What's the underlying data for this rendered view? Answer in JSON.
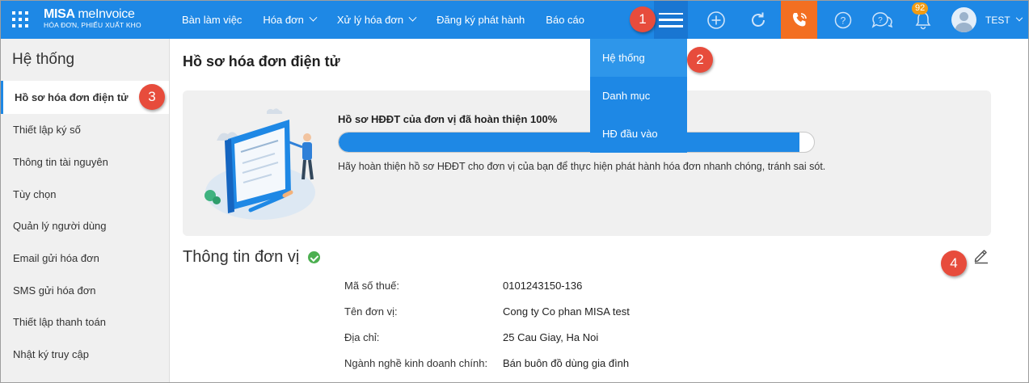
{
  "header": {
    "logo_main_bold": "MISA",
    "logo_main_light": "meInvoice",
    "logo_sub": "HÓA ĐƠN, PHIẾU XUẤT KHO",
    "nav": [
      {
        "label": "Bàn làm việc",
        "has_dropdown": false
      },
      {
        "label": "Hóa đơn",
        "has_dropdown": true
      },
      {
        "label": "Xử lý hóa đơn",
        "has_dropdown": true
      },
      {
        "label": "Đăng ký phát hành",
        "has_dropdown": false
      },
      {
        "label": "Báo cáo",
        "has_dropdown": false
      }
    ],
    "notification_count": "92",
    "user_name": "TEST",
    "icons": [
      "apps-grid-icon",
      "hamburger-icon",
      "plus-circle-icon",
      "refresh-icon",
      "phone-icon",
      "help-icon",
      "chat-icon",
      "bell-icon"
    ],
    "accent_color": "#1e88e5",
    "phone_color": "#f36f21"
  },
  "dropdown": {
    "items": [
      "Hệ thống",
      "Danh mục",
      "HĐ đầu vào"
    ]
  },
  "sidebar": {
    "title": "Hệ thống",
    "items": [
      "Hồ sơ hóa đơn điện tử",
      "Thiết lập ký số",
      "Thông tin tài nguyên",
      "Tùy chọn",
      "Quản lý người dùng",
      "Email gửi hóa đơn",
      "SMS gửi hóa đơn",
      "Thiết lập thanh toán",
      "Nhật ký truy cập"
    ]
  },
  "main": {
    "page_title": "Hồ sơ hóa đơn điện tử",
    "card": {
      "title": "Hồ sơ HĐĐT của đơn vị đã hoàn thiện 100%",
      "progress_percent": 100,
      "description": "Hãy hoàn thiện hồ sơ HĐĐT cho đơn vị của bạn để thực hiện phát hành hóa đơn nhanh chóng, tránh sai sót."
    },
    "section_title": "Thông tin đơn vị",
    "info": [
      {
        "label": "Mã số thuế:",
        "value": "0101243150-136"
      },
      {
        "label": "Tên đơn vị:",
        "value": "Cong ty Co phan MISA test"
      },
      {
        "label": "Địa chỉ:",
        "value": "25 Cau Giay, Ha Noi"
      },
      {
        "label": "Ngành nghề kinh doanh chính:",
        "value": "Bán buôn đồ dùng gia đình"
      }
    ]
  },
  "callouts": [
    "1",
    "2",
    "3",
    "4"
  ]
}
